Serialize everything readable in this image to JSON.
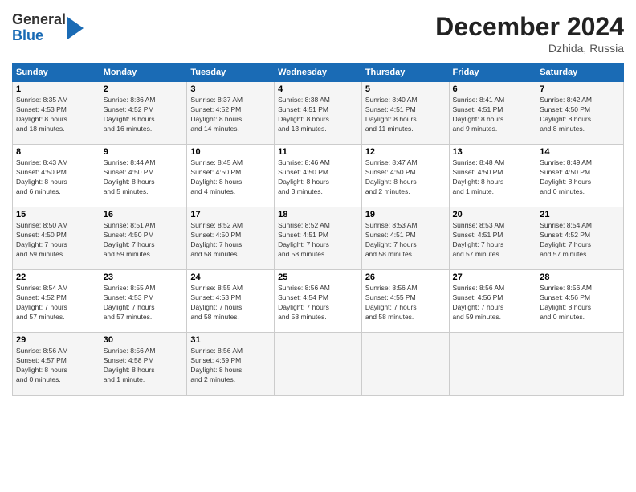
{
  "header": {
    "logo_general": "General",
    "logo_blue": "Blue",
    "month_title": "December 2024",
    "location": "Dzhida, Russia"
  },
  "days_of_week": [
    "Sunday",
    "Monday",
    "Tuesday",
    "Wednesday",
    "Thursday",
    "Friday",
    "Saturday"
  ],
  "weeks": [
    [
      {
        "day": "1",
        "info": "Sunrise: 8:35 AM\nSunset: 4:53 PM\nDaylight: 8 hours\nand 18 minutes."
      },
      {
        "day": "2",
        "info": "Sunrise: 8:36 AM\nSunset: 4:52 PM\nDaylight: 8 hours\nand 16 minutes."
      },
      {
        "day": "3",
        "info": "Sunrise: 8:37 AM\nSunset: 4:52 PM\nDaylight: 8 hours\nand 14 minutes."
      },
      {
        "day": "4",
        "info": "Sunrise: 8:38 AM\nSunset: 4:51 PM\nDaylight: 8 hours\nand 13 minutes."
      },
      {
        "day": "5",
        "info": "Sunrise: 8:40 AM\nSunset: 4:51 PM\nDaylight: 8 hours\nand 11 minutes."
      },
      {
        "day": "6",
        "info": "Sunrise: 8:41 AM\nSunset: 4:51 PM\nDaylight: 8 hours\nand 9 minutes."
      },
      {
        "day": "7",
        "info": "Sunrise: 8:42 AM\nSunset: 4:50 PM\nDaylight: 8 hours\nand 8 minutes."
      }
    ],
    [
      {
        "day": "8",
        "info": "Sunrise: 8:43 AM\nSunset: 4:50 PM\nDaylight: 8 hours\nand 6 minutes."
      },
      {
        "day": "9",
        "info": "Sunrise: 8:44 AM\nSunset: 4:50 PM\nDaylight: 8 hours\nand 5 minutes."
      },
      {
        "day": "10",
        "info": "Sunrise: 8:45 AM\nSunset: 4:50 PM\nDaylight: 8 hours\nand 4 minutes."
      },
      {
        "day": "11",
        "info": "Sunrise: 8:46 AM\nSunset: 4:50 PM\nDaylight: 8 hours\nand 3 minutes."
      },
      {
        "day": "12",
        "info": "Sunrise: 8:47 AM\nSunset: 4:50 PM\nDaylight: 8 hours\nand 2 minutes."
      },
      {
        "day": "13",
        "info": "Sunrise: 8:48 AM\nSunset: 4:50 PM\nDaylight: 8 hours\nand 1 minute."
      },
      {
        "day": "14",
        "info": "Sunrise: 8:49 AM\nSunset: 4:50 PM\nDaylight: 8 hours\nand 0 minutes."
      }
    ],
    [
      {
        "day": "15",
        "info": "Sunrise: 8:50 AM\nSunset: 4:50 PM\nDaylight: 7 hours\nand 59 minutes."
      },
      {
        "day": "16",
        "info": "Sunrise: 8:51 AM\nSunset: 4:50 PM\nDaylight: 7 hours\nand 59 minutes."
      },
      {
        "day": "17",
        "info": "Sunrise: 8:52 AM\nSunset: 4:50 PM\nDaylight: 7 hours\nand 58 minutes."
      },
      {
        "day": "18",
        "info": "Sunrise: 8:52 AM\nSunset: 4:51 PM\nDaylight: 7 hours\nand 58 minutes."
      },
      {
        "day": "19",
        "info": "Sunrise: 8:53 AM\nSunset: 4:51 PM\nDaylight: 7 hours\nand 58 minutes."
      },
      {
        "day": "20",
        "info": "Sunrise: 8:53 AM\nSunset: 4:51 PM\nDaylight: 7 hours\nand 57 minutes."
      },
      {
        "day": "21",
        "info": "Sunrise: 8:54 AM\nSunset: 4:52 PM\nDaylight: 7 hours\nand 57 minutes."
      }
    ],
    [
      {
        "day": "22",
        "info": "Sunrise: 8:54 AM\nSunset: 4:52 PM\nDaylight: 7 hours\nand 57 minutes."
      },
      {
        "day": "23",
        "info": "Sunrise: 8:55 AM\nSunset: 4:53 PM\nDaylight: 7 hours\nand 57 minutes."
      },
      {
        "day": "24",
        "info": "Sunrise: 8:55 AM\nSunset: 4:53 PM\nDaylight: 7 hours\nand 58 minutes."
      },
      {
        "day": "25",
        "info": "Sunrise: 8:56 AM\nSunset: 4:54 PM\nDaylight: 7 hours\nand 58 minutes."
      },
      {
        "day": "26",
        "info": "Sunrise: 8:56 AM\nSunset: 4:55 PM\nDaylight: 7 hours\nand 58 minutes."
      },
      {
        "day": "27",
        "info": "Sunrise: 8:56 AM\nSunset: 4:56 PM\nDaylight: 7 hours\nand 59 minutes."
      },
      {
        "day": "28",
        "info": "Sunrise: 8:56 AM\nSunset: 4:56 PM\nDaylight: 8 hours\nand 0 minutes."
      }
    ],
    [
      {
        "day": "29",
        "info": "Sunrise: 8:56 AM\nSunset: 4:57 PM\nDaylight: 8 hours\nand 0 minutes."
      },
      {
        "day": "30",
        "info": "Sunrise: 8:56 AM\nSunset: 4:58 PM\nDaylight: 8 hours\nand 1 minute."
      },
      {
        "day": "31",
        "info": "Sunrise: 8:56 AM\nSunset: 4:59 PM\nDaylight: 8 hours\nand 2 minutes."
      },
      {
        "day": "",
        "info": ""
      },
      {
        "day": "",
        "info": ""
      },
      {
        "day": "",
        "info": ""
      },
      {
        "day": "",
        "info": ""
      }
    ]
  ]
}
